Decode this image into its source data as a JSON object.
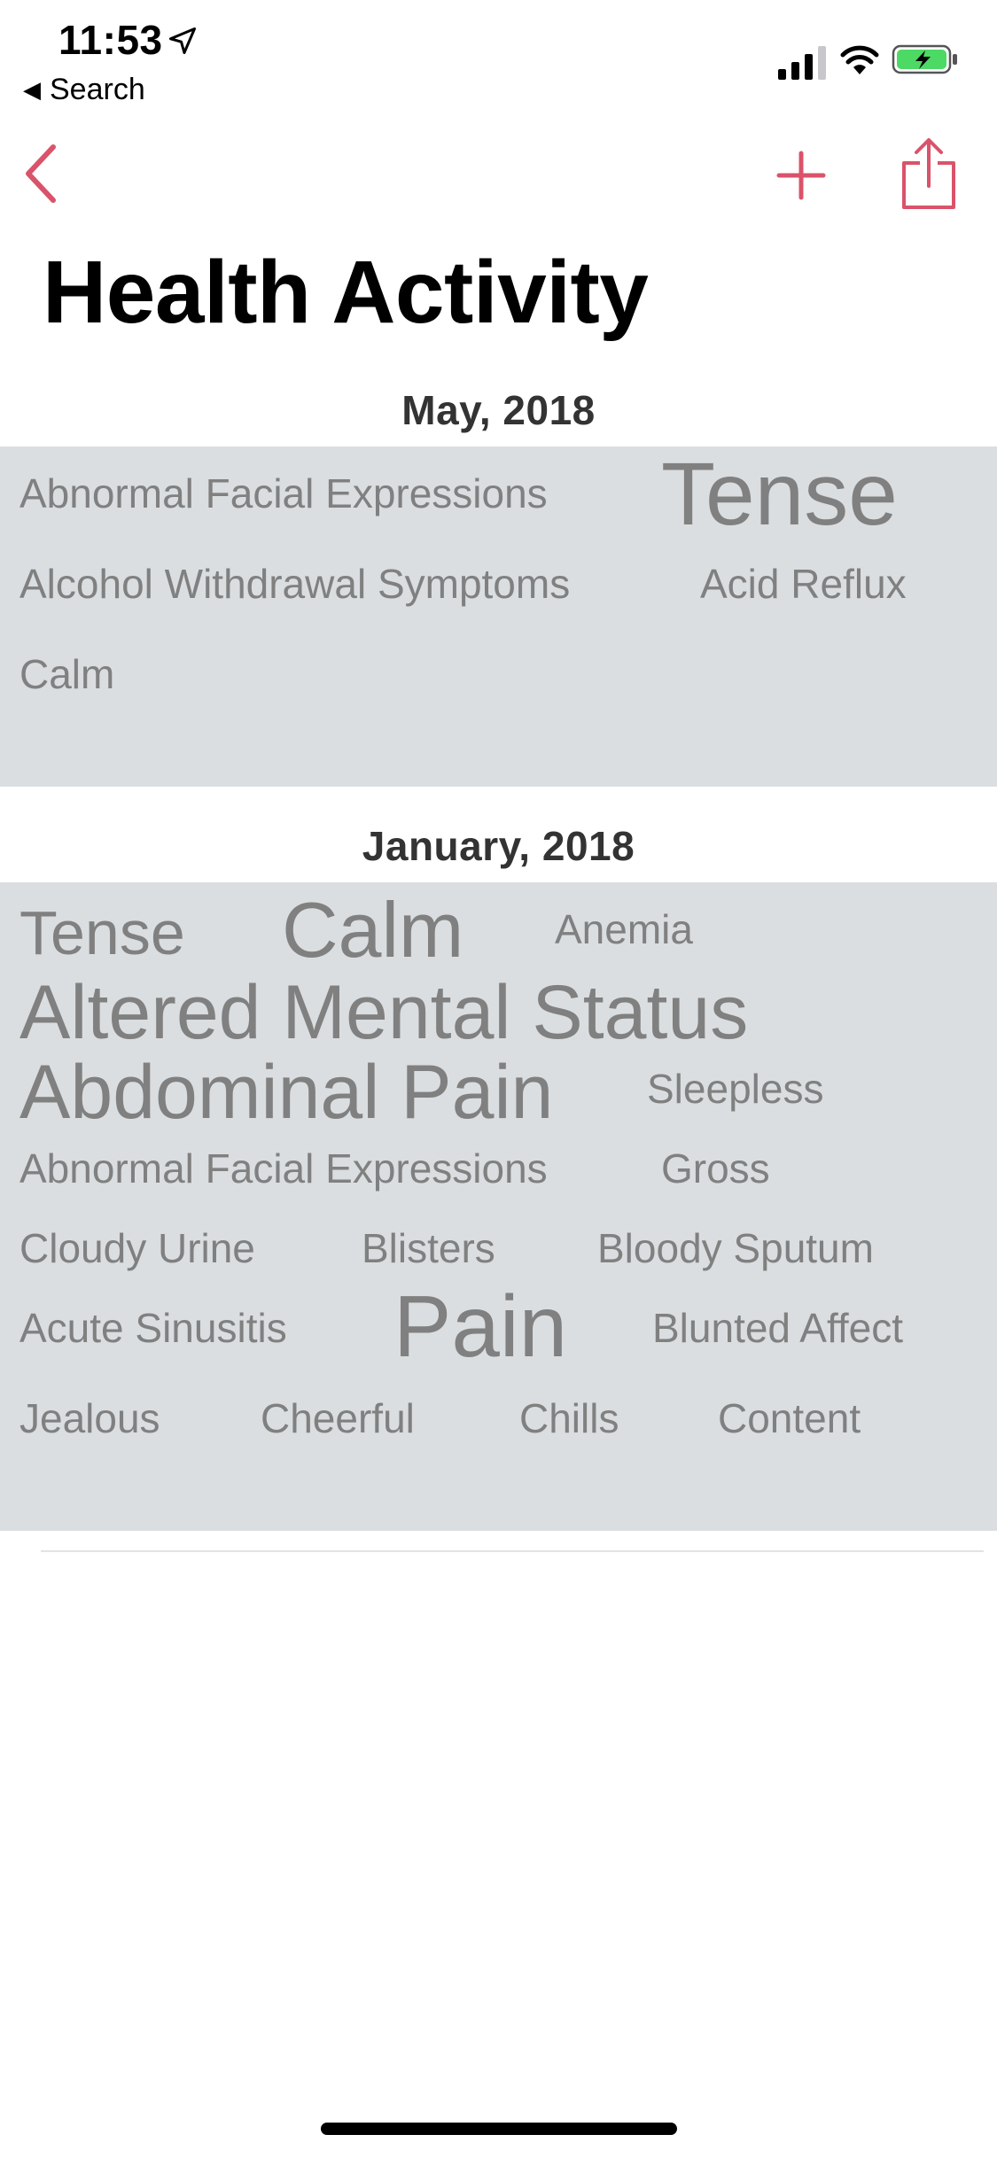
{
  "status_bar": {
    "time": "11:53",
    "back_app_label": "Search",
    "icons": [
      "location-arrow-icon",
      "cellular-signal-icon",
      "wifi-icon",
      "battery-charging-icon"
    ]
  },
  "nav": {
    "accent_color": "#d9536a",
    "icons": [
      "chevron-left-icon",
      "plus-icon",
      "share-icon"
    ]
  },
  "page": {
    "title": "Health Activity"
  },
  "colors": {
    "cloud_background": "#dadee0",
    "word_color": "#808080",
    "battery_fill": "#4cd964"
  },
  "sections": [
    {
      "month": "May,  2018",
      "words": [
        "Abnormal Facial Expressions",
        "Tense",
        "Alcohol Withdrawal Symptoms",
        "Acid Reflux",
        "Calm"
      ]
    },
    {
      "month": "January,  2018",
      "words": [
        "Tense",
        "Calm",
        "Anemia",
        "Altered Mental Status",
        "Abdominal Pain",
        "Sleepless",
        "Abnormal Facial Expressions",
        "Gross",
        "Cloudy Urine",
        "Blisters",
        "Bloody Sputum",
        "Acute Sinusitis",
        "Pain",
        "Blunted Affect",
        "Jealous",
        "Cheerful",
        "Chills",
        "Content"
      ]
    }
  ]
}
